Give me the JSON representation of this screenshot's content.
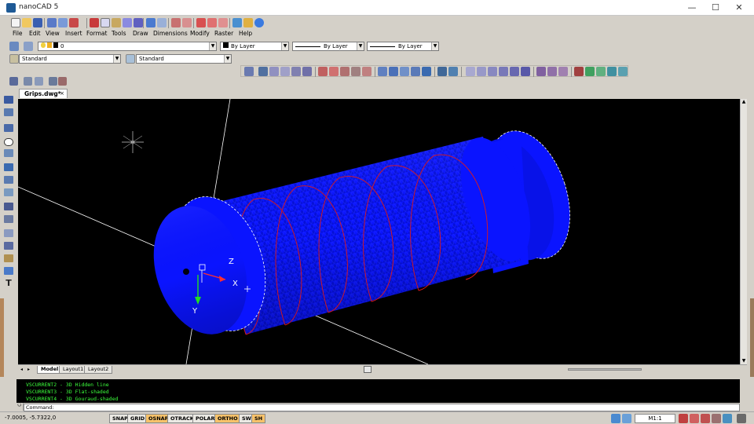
{
  "window": {
    "title": "nanoCAD 5",
    "minimize_label": "—",
    "maximize_label": "☐",
    "close_label": "✕"
  },
  "menu": [
    "File",
    "Edit",
    "View",
    "Insert",
    "Format",
    "Tools",
    "Draw",
    "Dimensions",
    "Modify",
    "Raster",
    "Help"
  ],
  "properties": {
    "layer_value": "0",
    "color_value": "By Layer",
    "linetype_value": "By Layer",
    "lineweight_value": "By Layer",
    "text_style": "Standard",
    "dim_style": "Standard"
  },
  "document": {
    "tab_label": "Grips.dwg*",
    "tab_close": "×"
  },
  "layout_tabs": [
    {
      "label": "Model",
      "active": true
    },
    {
      "label": "Layout1",
      "active": false
    },
    {
      "label": "Layout2",
      "active": false
    }
  ],
  "ucs": {
    "z_label": "Z",
    "x_label": "X",
    "y_label": "Y"
  },
  "command": {
    "side_label": "Command",
    "history": [
      "VSCURRENT2 - 3D Hidden line",
      "VSCURRENT3 - 3D Flat-shaded",
      "VSCURRENT4 - 3D Gouraud-shaded"
    ],
    "prompt": "Command:"
  },
  "status": {
    "coordinates": "-7.0005, -5.7322,0",
    "toggles": [
      {
        "label": "SNAP",
        "on": false
      },
      {
        "label": "GRID",
        "on": false
      },
      {
        "label": "OSNAP",
        "on": true
      },
      {
        "label": "OTRACK",
        "on": false
      },
      {
        "label": "POLAR",
        "on": false
      },
      {
        "label": "ORTHO",
        "on": true
      },
      {
        "label": "SW",
        "on": false
      },
      {
        "label": "SH",
        "on": true
      }
    ],
    "scale": "M1:1"
  },
  "colors": {
    "model_blue": "#0a14ff",
    "helix_red": "#e01818",
    "command_green": "#3cff3c",
    "toggle_on": "#f7c26a"
  }
}
